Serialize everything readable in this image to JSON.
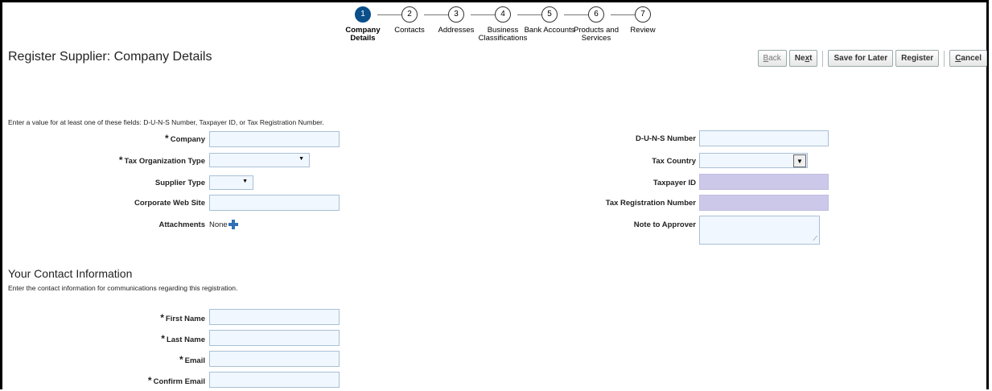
{
  "train": {
    "steps": [
      {
        "num": "1",
        "label_1": "Company",
        "label_2": "Details",
        "active": true
      },
      {
        "num": "2",
        "label_1": "Contacts",
        "label_2": ""
      },
      {
        "num": "3",
        "label_1": "Addresses",
        "label_2": ""
      },
      {
        "num": "4",
        "label_1": "Business",
        "label_2": "Classifications"
      },
      {
        "num": "5",
        "label_1": "Bank Accounts",
        "label_2": ""
      },
      {
        "num": "6",
        "label_1": "Products and",
        "label_2": "Services"
      },
      {
        "num": "7",
        "label_1": "Review",
        "label_2": ""
      }
    ]
  },
  "page_title": "Register Supplier: Company Details",
  "buttons": {
    "back": {
      "pre": "",
      "u": "B",
      "post": "ack"
    },
    "next": {
      "pre": "Ne",
      "u": "x",
      "post": "t"
    },
    "save_for_later": "Save for Later",
    "register": "Register",
    "cancel": {
      "pre": "",
      "u": "C",
      "post": "ancel"
    }
  },
  "company_info_text": "Enter a value for at least one of these fields: D-U-N-S Number, Taxpayer ID, or Tax Registration Number.",
  "left_fields": {
    "company": "Company",
    "tax_org_type": "Tax Organization Type",
    "supplier_type": "Supplier Type",
    "corporate_web_site": "Corporate Web Site",
    "attachments": "Attachments",
    "attachments_value": "None"
  },
  "right_fields": {
    "duns": "D-U-N-S Number",
    "tax_country": "Tax Country",
    "taxpayer_id": "Taxpayer ID",
    "tax_reg_number": "Tax Registration Number",
    "note_to_approver": "Note to Approver"
  },
  "contact": {
    "title": "Your Contact Information",
    "info": "Enter the contact information for communications regarding this registration.",
    "first_name": "First Name",
    "last_name": "Last Name",
    "email": "Email",
    "confirm_email": "Confirm Email"
  },
  "required_marker": "*",
  "icons": {
    "dropdown": "down-triangle-icon",
    "add": "plus-icon"
  },
  "colors": {
    "active_step": "#0b4f8a",
    "input_bg": "#f1f7fe",
    "shaded_input_bg": "#ccc8ea",
    "add_icon": "#2f6fb5"
  }
}
